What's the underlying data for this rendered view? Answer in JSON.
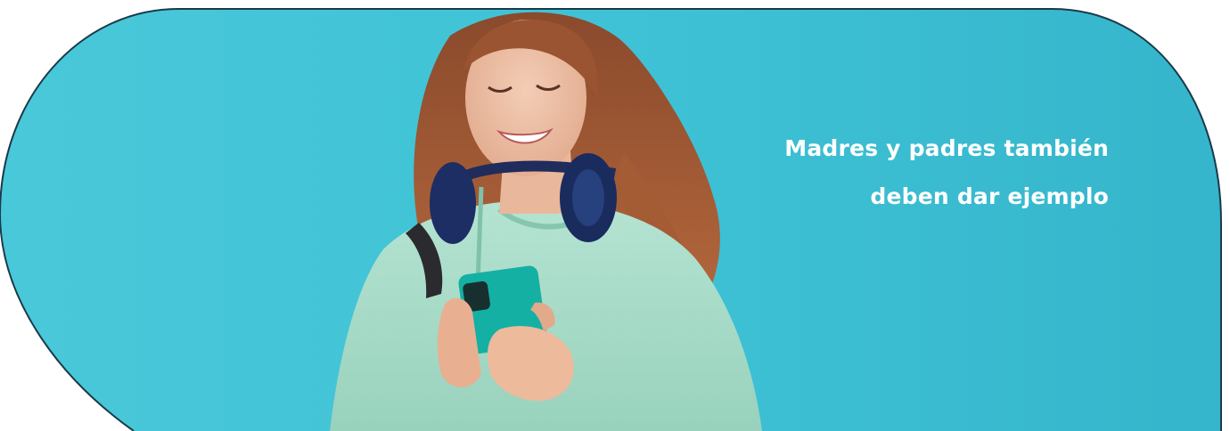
{
  "banner": {
    "headline_line1": "Madres y padres también",
    "headline_line2": "deben dar ejemplo"
  },
  "photo": {
    "subject": "smiling young woman with long auburn hair wearing over-ear headphones around her neck and a mint hoodie, looking at a smartphone",
    "background_color": "#3cc3d6",
    "hoodie_color": "#a9dcc8",
    "hair_color": "#a35a35",
    "headphones_color": "#1c2e64",
    "phone_color": "#16b3a4"
  }
}
